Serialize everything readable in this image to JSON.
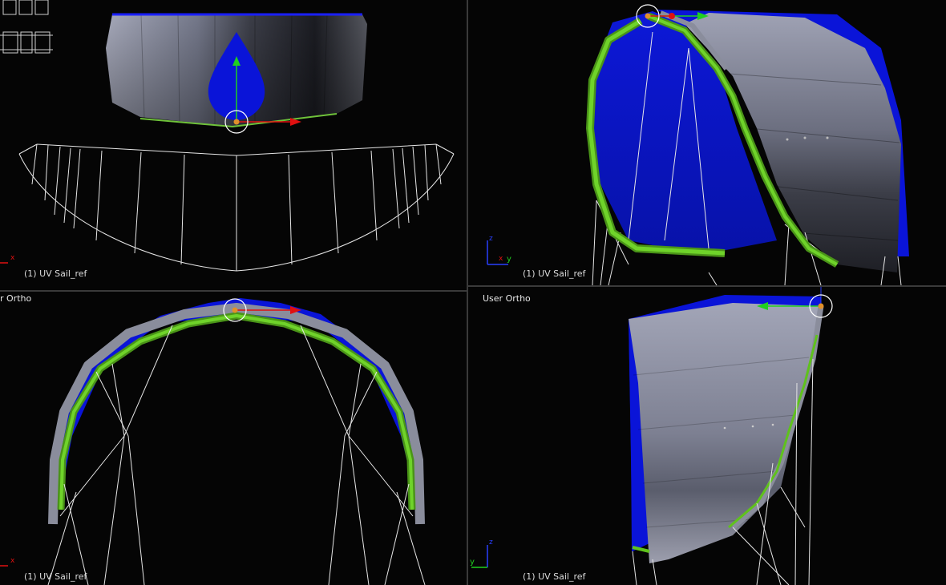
{
  "viewports": {
    "top_left": {
      "object_label": "(1) UV Sail_ref"
    },
    "top_right": {
      "object_label": "(1) UV Sail_ref"
    },
    "bottom_left": {
      "view_title": "r Ortho",
      "object_label": "(1) UV Sail_ref"
    },
    "bottom_right": {
      "view_title": "User Ortho",
      "object_label": "(1) UV Sail_ref"
    }
  },
  "axes": {
    "x": "x",
    "y": "y",
    "z": "z"
  },
  "colors": {
    "background": "#050505",
    "sail_grey": "#8a8d9e",
    "sail_blue": "#0a14d8",
    "leading_edge_green": "#5fc21c",
    "wire": "#e6e6e6",
    "axis_red": "#e01010",
    "axis_green": "#20d020",
    "axis_blue": "#2a40ff",
    "pivot_orange": "#e0902a"
  }
}
